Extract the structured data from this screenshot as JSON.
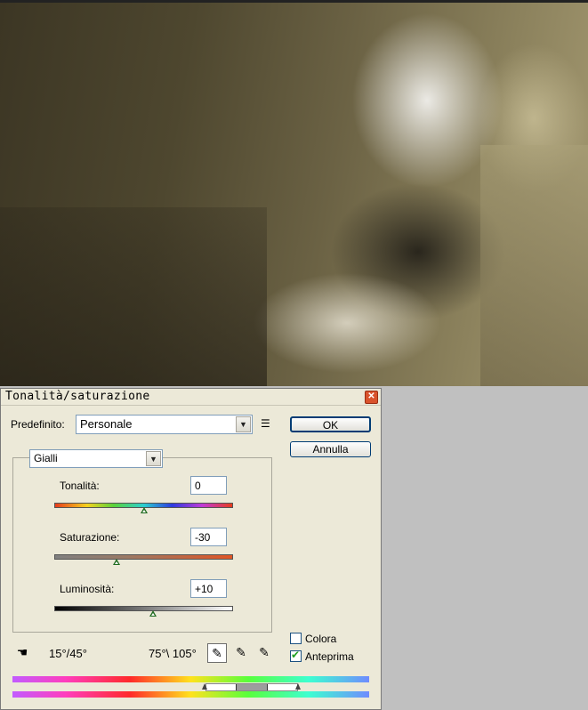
{
  "dialog": {
    "title": "Tonalità/saturazione",
    "preset_label": "Predefinito:",
    "preset_value": "Personale",
    "ok_label": "OK",
    "cancel_label": "Annulla",
    "channel_value": "Gialli",
    "hue_label": "Tonalità:",
    "hue_value": "0",
    "sat_label": "Saturazione:",
    "sat_value": "-30",
    "lum_label": "Luminosità:",
    "lum_value": "+10",
    "range_left": "15°/45°",
    "range_right": "75°\\ 105°",
    "colorize_label": "Colora",
    "colorize_checked": false,
    "preview_label": "Anteprima",
    "preview_checked": true
  },
  "sliders": {
    "hue_level": 0.5,
    "sat_level": 0.35,
    "lum_level": 0.55
  },
  "icons": [
    "close-icon",
    "preset-menu-icon",
    "chevron-down-icon",
    "hand-adjust-icon",
    "eyedropper-icon",
    "eyedropper-plus-icon",
    "eyedropper-minus-icon",
    "checkmark-icon"
  ]
}
